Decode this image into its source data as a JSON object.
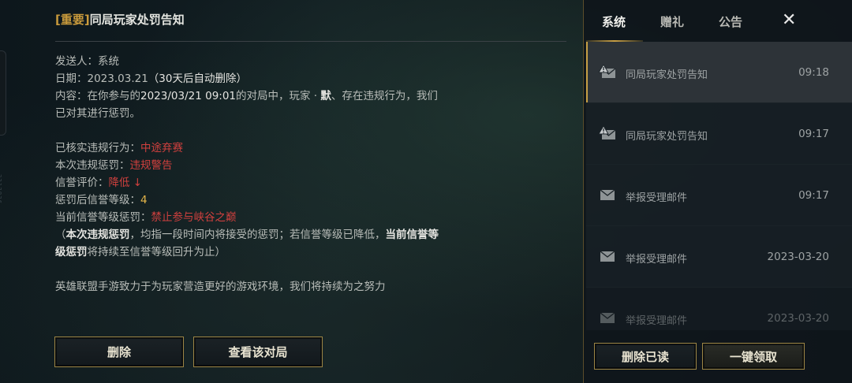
{
  "mail": {
    "tag": "[重要]",
    "title": "同局玩家处罚告知",
    "sender_label": "发送人：",
    "sender": "系统",
    "date_label": "日期：",
    "date": "2023.03.21",
    "date_note": "（30天后自动删除）",
    "content_prefix": "内容：在你参与的",
    "content_datetime": "2023/03/21 09:01",
    "content_mid": "的对局中，玩家 · ",
    "content_player": "默",
    "content_suffix": "、存在违规行为，我们已对其进行惩罚。",
    "violation_label": "已核实违规行为：",
    "violation_value": "中途弃赛",
    "penalty_label": "本次违规惩罚：",
    "penalty_value": "违规警告",
    "credit_label": "信誉评价：",
    "credit_value": "降低 ↓",
    "level_label": "惩罚后信誉等级：",
    "level_value": "4",
    "current_label": "当前信誉等级惩罚：",
    "current_value": "禁止参与峡谷之巅",
    "note_open": "（",
    "note_bold1": "本次违规惩罚",
    "note_mid": "，均指一段时间内将接受的惩罚；若信誉等级已降低，",
    "note_bold2": "当前信誉等级惩罚",
    "note_end": "将持续至信誉等级回升为止）",
    "closing": "英雄联盟手游致力于为玩家营造更好的游戏环境，我们将持续为之努力"
  },
  "actions": {
    "delete_label": "删除",
    "view_match_label": "查看该对局"
  },
  "panel": {
    "tabs": [
      "系统",
      "赠礼",
      "公告"
    ],
    "close_glyph": "✕",
    "items": [
      {
        "subject": "同局玩家处罚告知",
        "time": "09:18",
        "icon": "alert-envelope-icon"
      },
      {
        "subject": "同局玩家处罚告知",
        "time": "09:17",
        "icon": "alert-envelope-icon"
      },
      {
        "subject": "举报受理邮件",
        "time": "09:17",
        "icon": "envelope-icon"
      },
      {
        "subject": "举报受理邮件",
        "time": "2023-03-20",
        "icon": "envelope-icon"
      },
      {
        "subject": "举报受理邮件",
        "time": "2023-03-20",
        "icon": "envelope-icon"
      }
    ],
    "delete_read_label": "删除已读",
    "claim_all_label": "一键领取"
  },
  "side_code": "3213836",
  "colors": {
    "accent_gold": "#c99a3c",
    "warning_red": "#d0403e",
    "level_gold": "#e6b64a"
  }
}
